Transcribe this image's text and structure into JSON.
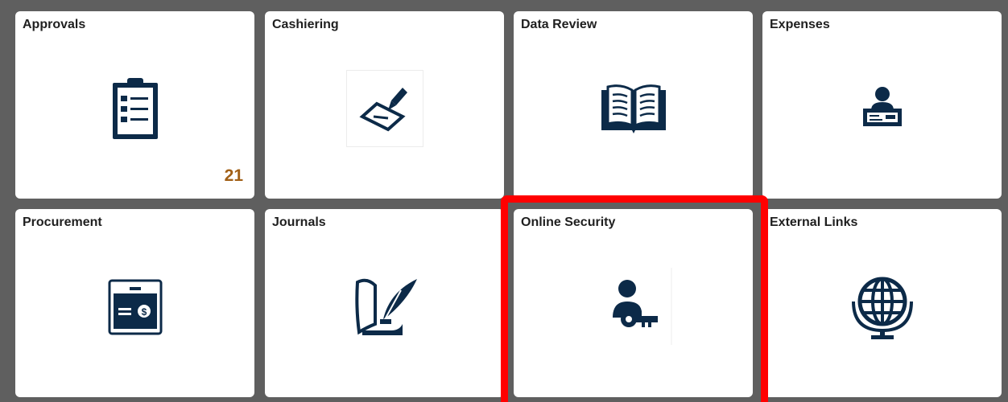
{
  "tiles": [
    {
      "id": "approvals",
      "title": "Approvals",
      "icon": "clipboard-checklist-icon",
      "badge": "21"
    },
    {
      "id": "cashiering",
      "title": "Cashiering",
      "icon": "pen-signing-check-icon"
    },
    {
      "id": "data-review",
      "title": "Data Review",
      "icon": "open-book-icon"
    },
    {
      "id": "expenses",
      "title": "Expenses",
      "icon": "person-holding-check-icon"
    },
    {
      "id": "procurement",
      "title": "Procurement",
      "icon": "wallet-card-icon"
    },
    {
      "id": "journals",
      "title": "Journals",
      "icon": "quill-scroll-icon"
    },
    {
      "id": "online-security",
      "title": "Online Security",
      "icon": "person-key-icon",
      "highlighted": true
    },
    {
      "id": "external-links",
      "title": "External Links",
      "icon": "globe-icon"
    }
  ],
  "colors": {
    "background": "#5f5f5f",
    "tile": "#ffffff",
    "icon": "#0c2a48",
    "badge": "#a15f16",
    "highlight": "#ff0000"
  }
}
